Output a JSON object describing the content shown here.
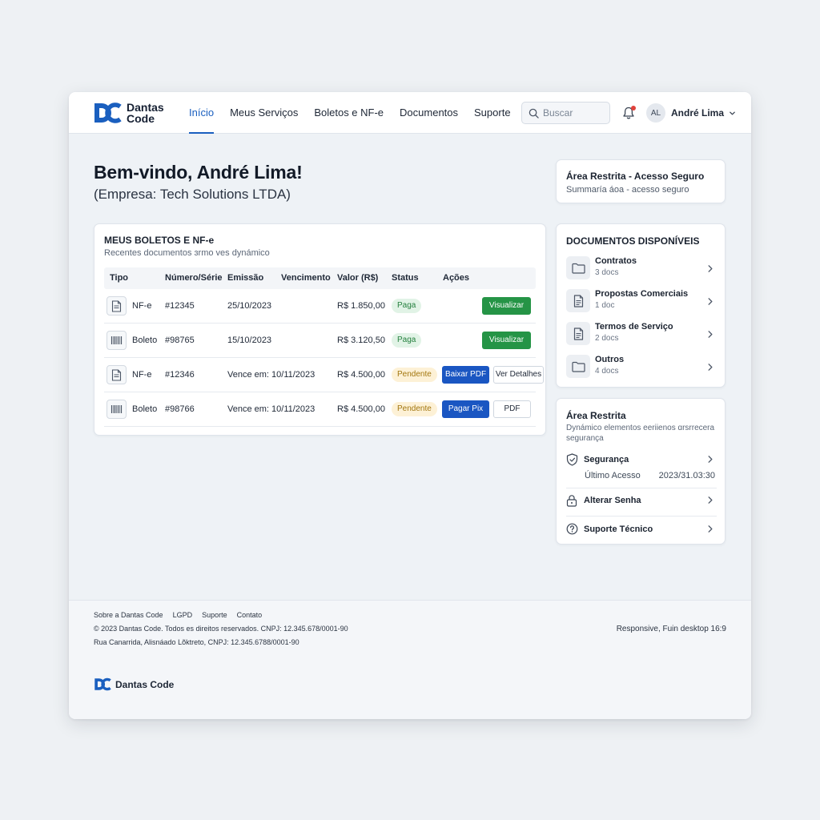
{
  "brand": {
    "line1": "Dantas",
    "line2": "Code",
    "footer_name": "Dantas Code",
    "color": "#1a5fbf"
  },
  "nav": {
    "items": [
      {
        "label": "Início",
        "active": true
      },
      {
        "label": "Meus Serviços"
      },
      {
        "label": "Boletos e NF-e"
      },
      {
        "label": "Documentos"
      },
      {
        "label": "Suporte"
      }
    ]
  },
  "search": {
    "placeholder": "Buscar",
    "value": ""
  },
  "user": {
    "initials": "AL",
    "name": "André Lima"
  },
  "welcome": {
    "title": "Bem-vindo, André Lima!",
    "subtitle": "(Empresa: Tech Solutions LTDA)"
  },
  "boletos": {
    "title": "MEUS BOLETOS E NF-e",
    "subtitle": "Recentes documentos ɜrmo ves dynámico",
    "columns": [
      "Tipo",
      "Número/Série",
      "Emissão",
      "Vencimento",
      "Valor (R$)",
      "Status",
      "Ações"
    ],
    "rows": [
      {
        "icon": "invoice-icon",
        "tipo": "NF-e",
        "numero": "#12345",
        "data": "25/10/2023",
        "valor": "R$ 1.850,00",
        "status": "Paga",
        "actions": [
          "Visualizar"
        ]
      },
      {
        "icon": "barcode-icon",
        "tipo": "Boleto",
        "numero": "#98765",
        "data": "15/10/2023",
        "valor": "R$ 3.120,50",
        "status": "Paga",
        "actions": [
          "Visualizar"
        ]
      },
      {
        "icon": "invoice-icon",
        "tipo": "NF-e",
        "numero": "#12346",
        "data": "Vence em: 10/11/2023",
        "valor": "R$ 4.500,00",
        "status": "Pendente",
        "actions": [
          "Baixar PDF",
          "Ver Detalhes"
        ]
      },
      {
        "icon": "barcode-icon",
        "tipo": "Boleto",
        "numero": "#98766",
        "data": "Vence em: 10/11/2023",
        "valor": "R$ 4.500,00",
        "status": "Pendente",
        "actions": [
          "Pagar Pix",
          "PDF"
        ]
      }
    ]
  },
  "restrita": {
    "title": "Área Restrita - Acesso Seguro",
    "subtitle": "Summaría áoa - acesso seguro"
  },
  "documentos": {
    "title": "DOCUMENTOS DISPONÍVEIS",
    "items": [
      {
        "icon": "folder-icon",
        "name": "Contratos",
        "count": "3 docs"
      },
      {
        "icon": "document-icon",
        "name": "Propostas Comerciais",
        "count": "1 doc"
      },
      {
        "icon": "document-icon",
        "name": "Termos de Serviço",
        "count": "2 docs"
      },
      {
        "icon": "folder-icon",
        "name": "Outros",
        "count": "4 docs"
      }
    ]
  },
  "area": {
    "title": "Área Restrita",
    "subtitle": "Dynámico elementos eeriienos ɑrsrrecera segurança",
    "seguranca": "Segurança",
    "ultimo_acesso_label": "Último Acesso",
    "ultimo_acesso_value": "2023/31.03:30",
    "alterar_senha": "Alterar Senha",
    "suporte": "Suporte Técnico"
  },
  "footer": {
    "links": [
      "Sobre a Dantas Code",
      "LGPD",
      "Suporte",
      "Contato"
    ],
    "line1": "© 2023 Dantas Code. Todos es direitos reservados. CNPJ: 12.345.678/0001-90",
    "line2": "Rua Canarrida, Alisnáado Lõktreto, CNPJ: 12.345.6788/0001-90",
    "right": "Responsive, Fuin desktop 16:9"
  },
  "colors": {
    "primary": "#1a5fbf",
    "success": "#259446",
    "action_blue": "#1a56c2",
    "paid_badge": "#e1f3e6",
    "pending_badge": "#fdf1d6",
    "notification": "#e0413b"
  }
}
